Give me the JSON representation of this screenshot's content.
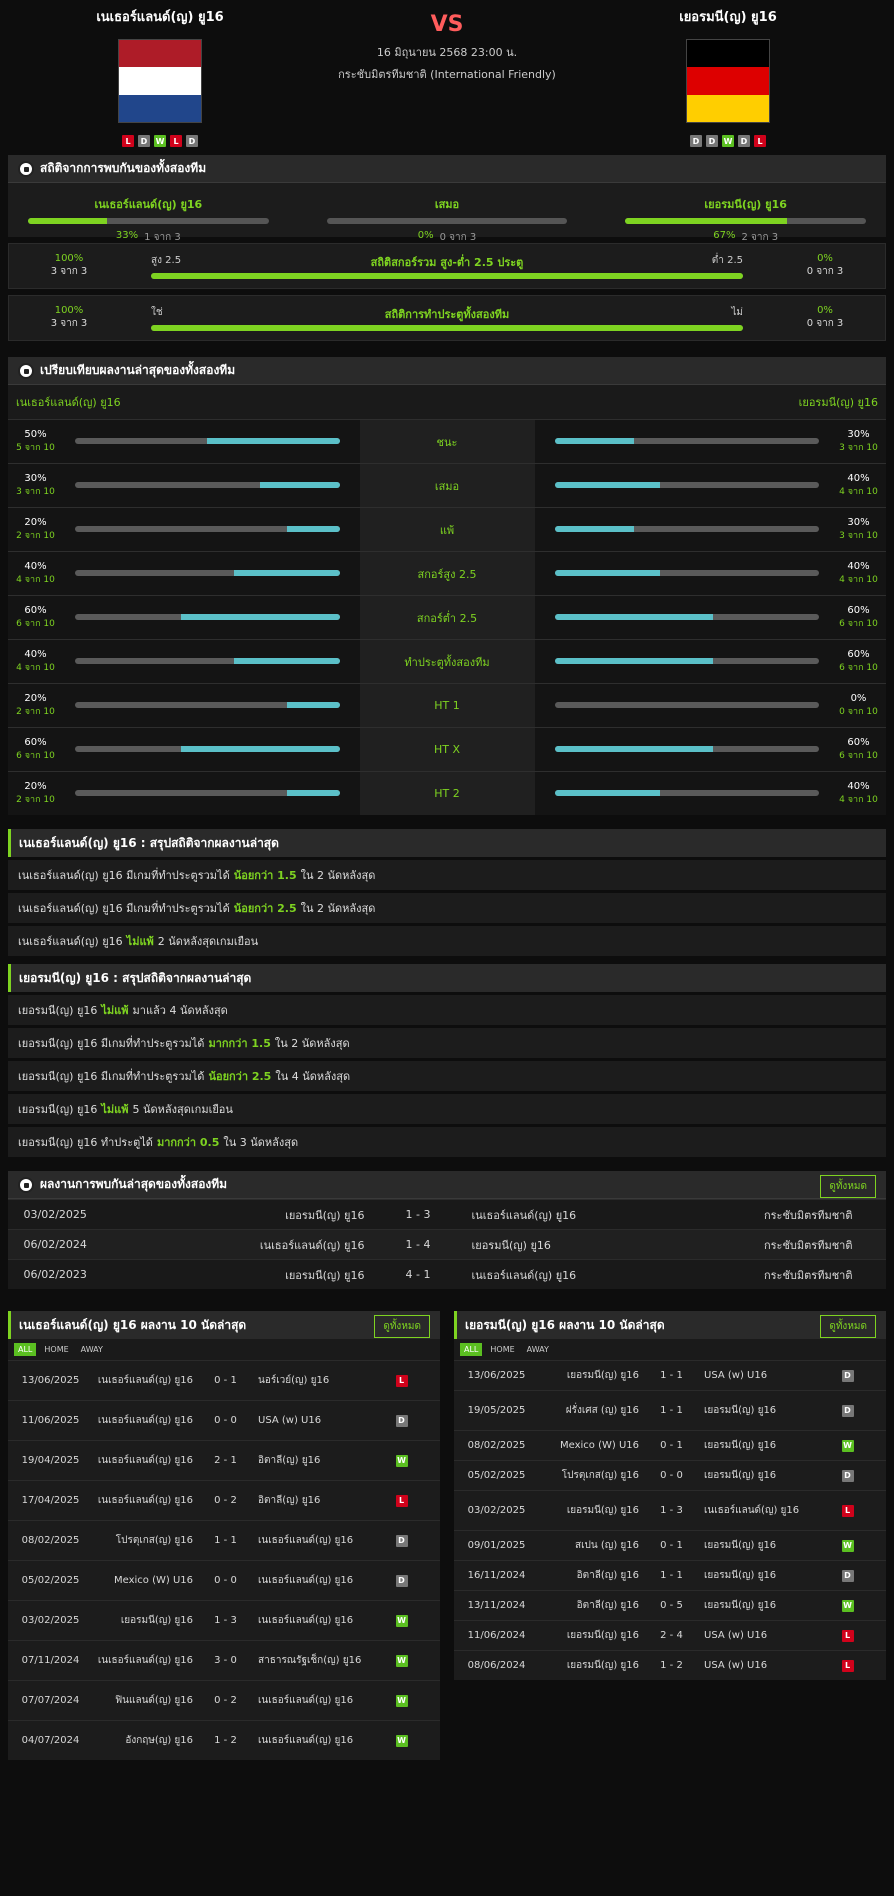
{
  "header": {
    "home": "เนเธอร์แลนด์(ญ) ยู16",
    "away": "เยอรมนี(ญ) ยู16",
    "vs": "VS",
    "datetime": "16 มิถุนายน 2568 23:00 น.",
    "competition": "กระชับมิตรทีมชาติ (International Friendly)",
    "home_form": [
      "L",
      "D",
      "W",
      "L",
      "D"
    ],
    "away_form": [
      "D",
      "D",
      "W",
      "D",
      "L"
    ],
    "home_flag": [
      "#ae1c28",
      "#ffffff",
      "#21468b"
    ],
    "away_flag": [
      "#000000",
      "#dd0000",
      "#ffce00"
    ]
  },
  "h2h_stats": {
    "title": "สถิติจากการพบกันของทั้งสองทีม",
    "home": {
      "label": "เนเธอร์แลนด์(ญ) ยู16",
      "pct": "33%",
      "pct_value": 0.33,
      "count": "1 จาก 3"
    },
    "draw": {
      "label": "เสมอ",
      "pct": "0%",
      "pct_value": 0,
      "count": "0 จาก 3"
    },
    "away": {
      "label": "เยอรมนี(ญ) ยู16",
      "pct": "67%",
      "pct_value": 0.67,
      "count": "2 จาก 3"
    },
    "ou": {
      "left_pct": "100%",
      "left_count": "3 จาก 3",
      "left_label": "สูง 2.5",
      "title": "สถิติสกอร์รวม สูง-ต่ำ 2.5 ประตู",
      "right_label": "ต่ำ 2.5",
      "right_pct": "0%",
      "right_count": "0 จาก 3",
      "fill": 1.0
    },
    "btts": {
      "left_pct": "100%",
      "left_count": "3 จาก 3",
      "left_label": "ใช่",
      "title": "สถิติการทำประตูทั้งสองทีม",
      "right_label": "ไม่",
      "right_pct": "0%",
      "right_count": "0 จาก 3",
      "fill": 1.0
    }
  },
  "compare": {
    "title": "เปรียบเทียบผลงานล่าสุดของทั้งสองทีม",
    "home": "เนเธอร์แลนด์(ญ) ยู16",
    "away": "เยอรมนี(ญ) ยู16",
    "rows": [
      {
        "label": "ชนะ",
        "hp": "50%",
        "hc": "5 จาก 10",
        "hv": 0.5,
        "ap": "30%",
        "ac": "3 จาก 10",
        "av": 0.3
      },
      {
        "label": "เสมอ",
        "hp": "30%",
        "hc": "3 จาก 10",
        "hv": 0.3,
        "ap": "40%",
        "ac": "4 จาก 10",
        "av": 0.4
      },
      {
        "label": "แพ้",
        "hp": "20%",
        "hc": "2 จาก 10",
        "hv": 0.2,
        "ap": "30%",
        "ac": "3 จาก 10",
        "av": 0.3
      },
      {
        "label": "สกอร์สูง 2.5",
        "hp": "40%",
        "hc": "4 จาก 10",
        "hv": 0.4,
        "ap": "40%",
        "ac": "4 จาก 10",
        "av": 0.4
      },
      {
        "label": "สกอร์ต่ำ 2.5",
        "hp": "60%",
        "hc": "6 จาก 10",
        "hv": 0.6,
        "ap": "60%",
        "ac": "6 จาก 10",
        "av": 0.6
      },
      {
        "label": "ทำประตูทั้งสองทีม",
        "hp": "40%",
        "hc": "4 จาก 10",
        "hv": 0.4,
        "ap": "60%",
        "ac": "6 จาก 10",
        "av": 0.6
      },
      {
        "label": "HT 1",
        "hp": "20%",
        "hc": "2 จาก 10",
        "hv": 0.2,
        "ap": "0%",
        "ac": "0 จาก 10",
        "av": 0
      },
      {
        "label": "HT X",
        "hp": "60%",
        "hc": "6 จาก 10",
        "hv": 0.6,
        "ap": "60%",
        "ac": "6 จาก 10",
        "av": 0.6
      },
      {
        "label": "HT 2",
        "hp": "20%",
        "hc": "2 จาก 10",
        "hv": 0.2,
        "ap": "40%",
        "ac": "4 จาก 10",
        "av": 0.4
      }
    ]
  },
  "home_summary": {
    "title": "เนเธอร์แลนด์(ญ) ยู16 : สรุปสถิติจากผลงานล่าสุด",
    "items": [
      [
        "เนเธอร์แลนด์(ญ) ยู16  มีเกมที่ทำประตูรวมได้",
        "น้อยกว่า  1.5",
        "ใน 2 นัดหลังสุด"
      ],
      [
        "เนเธอร์แลนด์(ญ) ยู16  มีเกมที่ทำประตูรวมได้",
        "น้อยกว่า  2.5",
        "ใน 2 นัดหลังสุด"
      ],
      [
        "เนเธอร์แลนด์(ญ) ยู16",
        "ไม่แพ้",
        "2  นัดหลังสุดเกมเยือน"
      ]
    ]
  },
  "away_summary": {
    "title": "เยอรมนี(ญ) ยู16 : สรุปสถิติจากผลงานล่าสุด",
    "items": [
      [
        "เยอรมนี(ญ) ยู16",
        "ไม่แพ้",
        "มาแล้ว 4 นัดหลังสุด"
      ],
      [
        "เยอรมนี(ญ) ยู16  มีเกมที่ทำประตูรวมได้",
        "มากกว่า  1.5",
        "ใน 2 นัดหลังสุด"
      ],
      [
        "เยอรมนี(ญ) ยู16  มีเกมที่ทำประตูรวมได้",
        "น้อยกว่า  2.5",
        "ใน 4 นัดหลังสุด"
      ],
      [
        "เยอรมนี(ญ) ยู16",
        "ไม่แพ้",
        "5  นัดหลังสุดเกมเยือน"
      ],
      [
        "เยอรมนี(ญ) ยู16  ทำประตูได้",
        "มากกว่า  0.5",
        "ใน 3 นัดหลังสุด"
      ]
    ]
  },
  "h2h_results": {
    "title": "ผลงานการพบกันล่าสุดของทั้งสองทีม",
    "view_all": "ดูทั้งหมด",
    "rows": [
      [
        "03/02/2025",
        "เยอรมนี(ญ) ยู16",
        "1 - 3",
        "เนเธอร์แลนด์(ญ) ยู16",
        "กระชับมิตรทีมชาติ"
      ],
      [
        "06/02/2024",
        "เนเธอร์แลนด์(ญ) ยู16",
        "1 - 4",
        "เยอรมนี(ญ) ยู16",
        "กระชับมิตรทีมชาติ"
      ],
      [
        "06/02/2023",
        "เยอรมนี(ญ) ยู16",
        "4 - 1",
        "เนเธอร์แลนด์(ญ) ยู16",
        "กระชับมิตรทีมชาติ"
      ]
    ]
  },
  "tabs": [
    "ALL",
    "HOME",
    "AWAY"
  ],
  "home_last10": {
    "title": "เนเธอร์แลนด์(ญ) ยู16 ผลงาน 10 นัดล่าสุด",
    "view_all": "ดูทั้งหมด",
    "rows": [
      [
        "13/06/2025",
        "เนเธอร์แลนด์(ญ) ยู16",
        "0 - 1",
        "นอร์เวย์(ญ) ยู16",
        "L"
      ],
      [
        "11/06/2025",
        "เนเธอร์แลนด์(ญ) ยู16",
        "0 - 0",
        "USA (w) U16",
        "D"
      ],
      [
        "19/04/2025",
        "เนเธอร์แลนด์(ญ) ยู16",
        "2 - 1",
        "อิตาลี(ญ) ยู16",
        "W"
      ],
      [
        "17/04/2025",
        "เนเธอร์แลนด์(ญ) ยู16",
        "0 - 2",
        "อิตาลี(ญ) ยู16",
        "L"
      ],
      [
        "08/02/2025",
        "โปรตุเกส(ญ) ยู16",
        "1 - 1",
        "เนเธอร์แลนด์(ญ) ยู16",
        "D"
      ],
      [
        "05/02/2025",
        "Mexico (W) U16",
        "0 - 0",
        "เนเธอร์แลนด์(ญ) ยู16",
        "D"
      ],
      [
        "03/02/2025",
        "เยอรมนี(ญ) ยู16",
        "1 - 3",
        "เนเธอร์แลนด์(ญ) ยู16",
        "W"
      ],
      [
        "07/11/2024",
        "เนเธอร์แลนด์(ญ) ยู16",
        "3 - 0",
        "สาธารณรัฐเช็ก(ญ) ยู16",
        "W"
      ],
      [
        "07/07/2024",
        "ฟินแลนด์(ญ) ยู16",
        "0 - 2",
        "เนเธอร์แลนด์(ญ) ยู16",
        "W"
      ],
      [
        "04/07/2024",
        "อังกฤษ(ญ) ยู16",
        "1 - 2",
        "เนเธอร์แลนด์(ญ) ยู16",
        "W"
      ]
    ]
  },
  "away_last10": {
    "title": "เยอรมนี(ญ) ยู16 ผลงาน 10 นัดล่าสุด",
    "view_all": "ดูทั้งหมด",
    "rows": [
      [
        "13/06/2025",
        "เยอรมนี(ญ) ยู16",
        "1 - 1",
        "USA (w) U16",
        "D"
      ],
      [
        "19/05/2025",
        "ฝรั่งเศส (ญ) ยู16",
        "1 - 1",
        "เยอรมนี(ญ) ยู16",
        "D"
      ],
      [
        "08/02/2025",
        "Mexico (W) U16",
        "0 - 1",
        "เยอรมนี(ญ) ยู16",
        "W"
      ],
      [
        "05/02/2025",
        "โปรตุเกส(ญ) ยู16",
        "0 - 0",
        "เยอรมนี(ญ) ยู16",
        "D"
      ],
      [
        "03/02/2025",
        "เยอรมนี(ญ) ยู16",
        "1 - 3",
        "เนเธอร์แลนด์(ญ) ยู16",
        "L"
      ],
      [
        "09/01/2025",
        "สเปน (ญ) ยู16",
        "0 - 1",
        "เยอรมนี(ญ) ยู16",
        "W"
      ],
      [
        "16/11/2024",
        "อิตาลี(ญ) ยู16",
        "1 - 1",
        "เยอรมนี(ญ) ยู16",
        "D"
      ],
      [
        "13/11/2024",
        "อิตาลี(ญ) ยู16",
        "0 - 5",
        "เยอรมนี(ญ) ยู16",
        "W"
      ],
      [
        "11/06/2024",
        "เยอรมนี(ญ) ยู16",
        "2 - 4",
        "USA (w) U16",
        "L"
      ],
      [
        "08/06/2024",
        "เยอรมนี(ญ) ยู16",
        "1 - 2",
        "USA (w) U16",
        "L"
      ]
    ]
  }
}
